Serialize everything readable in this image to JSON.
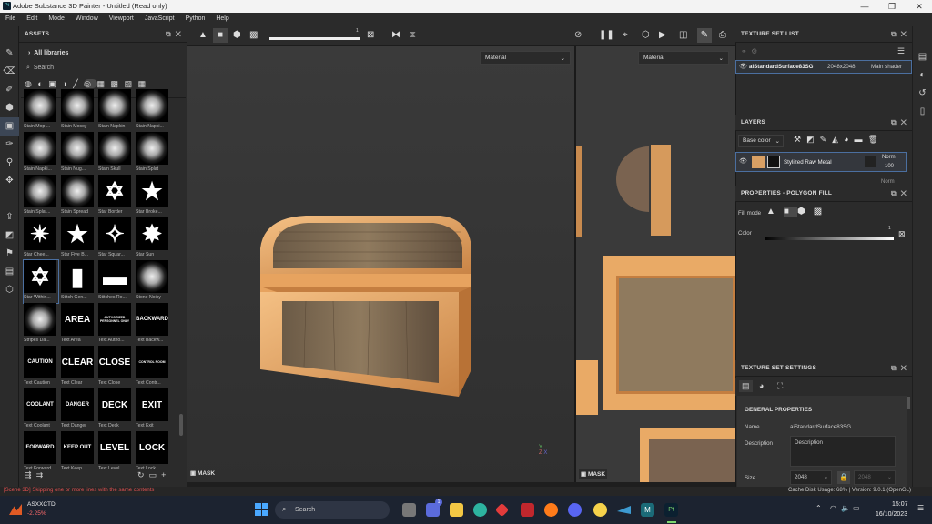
{
  "window": {
    "title": "Adobe Substance 3D Painter - Untitled (Read only)",
    "app_badge": "Pt",
    "controls": [
      "—",
      "❐",
      "✕"
    ]
  },
  "menu": [
    "File",
    "Edit",
    "Mode",
    "Window",
    "Viewport",
    "JavaScript",
    "Python",
    "Help"
  ],
  "assets": {
    "title": "ASSETS",
    "breadcrumb": "All libraries",
    "search_placeholder": "Search",
    "items": [
      {
        "label": "Stain Mop ...",
        "glyph": "",
        "kind": "splat"
      },
      {
        "label": "Stain Mossy",
        "glyph": "",
        "kind": "splat"
      },
      {
        "label": "Stain Napkin",
        "glyph": "",
        "kind": "splat"
      },
      {
        "label": "Stain Napki...",
        "glyph": "",
        "kind": "splat"
      },
      {
        "label": "Stain Napki...",
        "glyph": "",
        "kind": "splat"
      },
      {
        "label": "Stain Nug...",
        "glyph": "",
        "kind": "splat"
      },
      {
        "label": "Stain Skull",
        "glyph": "",
        "kind": "splat"
      },
      {
        "label": "Stain Splat",
        "glyph": "",
        "kind": "splat"
      },
      {
        "label": "Stain Splat...",
        "glyph": "",
        "kind": "splat"
      },
      {
        "label": "Stain Spread",
        "glyph": "",
        "kind": "splat"
      },
      {
        "label": "Star Border",
        "glyph": "✡",
        "kind": "star"
      },
      {
        "label": "Star Broke...",
        "glyph": "★",
        "kind": "star"
      },
      {
        "label": "Star Chee...",
        "glyph": "✴",
        "kind": "star"
      },
      {
        "label": "Star Five B...",
        "glyph": "★",
        "kind": "star"
      },
      {
        "label": "Star Squar...",
        "glyph": "✧",
        "kind": "star"
      },
      {
        "label": "Star Sun",
        "glyph": "✸",
        "kind": "star"
      },
      {
        "label": "Star Within...",
        "glyph": "✡",
        "kind": "star"
      },
      {
        "label": "Stitch Gen...",
        "glyph": "▮",
        "kind": "star"
      },
      {
        "label": "Stitches Ro...",
        "glyph": "▬",
        "kind": "star"
      },
      {
        "label": "Stone Noisy",
        "glyph": "",
        "kind": "splat"
      },
      {
        "label": "Stripes Da...",
        "glyph": "",
        "kind": "splat"
      },
      {
        "label": "Text Area",
        "glyph": "AREA",
        "kind": "text"
      },
      {
        "label": "Text Autho...",
        "glyph": "AUTHORIZED PERSONNEL ONLY",
        "kind": "text-small"
      },
      {
        "label": "Text Backw...",
        "glyph": "BACKWARD",
        "kind": "text-mid"
      },
      {
        "label": "Text Caution",
        "glyph": "CAUTION",
        "kind": "text-mid"
      },
      {
        "label": "Text Clear",
        "glyph": "CLEAR",
        "kind": "text"
      },
      {
        "label": "Text Close",
        "glyph": "CLOSE",
        "kind": "text"
      },
      {
        "label": "Text Contr...",
        "glyph": "CONTROL ROOM",
        "kind": "text-small"
      },
      {
        "label": "Text Coolant",
        "glyph": "COOLANT",
        "kind": "text-mid"
      },
      {
        "label": "Text Danger",
        "glyph": "DANGER",
        "kind": "text-mid"
      },
      {
        "label": "Text Deck",
        "glyph": "DECK",
        "kind": "text"
      },
      {
        "label": "Text Exit",
        "glyph": "EXIT",
        "kind": "text"
      },
      {
        "label": "Text Forward",
        "glyph": "FORWARD",
        "kind": "text-mid"
      },
      {
        "label": "Text Keep ...",
        "glyph": "KEEP OUT",
        "kind": "text-mid"
      },
      {
        "label": "Text Level",
        "glyph": "LEVEL",
        "kind": "text"
      },
      {
        "label": "Text Lock",
        "glyph": "LOCK",
        "kind": "text"
      }
    ]
  },
  "viewport": {
    "left_material": "Material",
    "right_material": "Material",
    "slider_value": "1",
    "mask_label": "MASK",
    "mask_label_right": "MASK"
  },
  "texture_set_list": {
    "title": "TEXTURE SET LIST",
    "row": {
      "name": "aiStandardSurface83SG",
      "resolution": "2048x2048",
      "shader": "Main shader"
    }
  },
  "layers": {
    "title": "LAYERS",
    "channel": "Base color",
    "layer": {
      "name": "Stylized Raw Metal",
      "blend": "Norm",
      "opacity": "100"
    },
    "next_blend": "Norm"
  },
  "properties": {
    "title": "PROPERTIES - POLYGON FILL",
    "fill_mode_label": "Fill mode",
    "color_label": "Color",
    "color_value": "1"
  },
  "texture_set_settings": {
    "title": "TEXTURE SET SETTINGS",
    "section": "GENERAL PROPERTIES",
    "name_label": "Name",
    "name_value": "aiStandardSurface83SG",
    "description_label": "Description",
    "description_value": "Description",
    "size_label": "Size",
    "size_value": "2048",
    "size_value2": "2048"
  },
  "status": {
    "message": "[Scene 3D] Skipping one or more lines with the same contents",
    "disk": "Cache Disk Usage:   68%  |  Version: 9.0.1 (OpenGL)"
  },
  "taskbar": {
    "ticker": "ASXXCTD",
    "change": "-2.25%",
    "search_placeholder": "Search",
    "time": "15:07",
    "date": "16/10/2023",
    "badge": "1"
  },
  "colors": {
    "accent": "#4b6fa0",
    "chest_copper": "#e0a060",
    "status_red": "#e05050"
  }
}
